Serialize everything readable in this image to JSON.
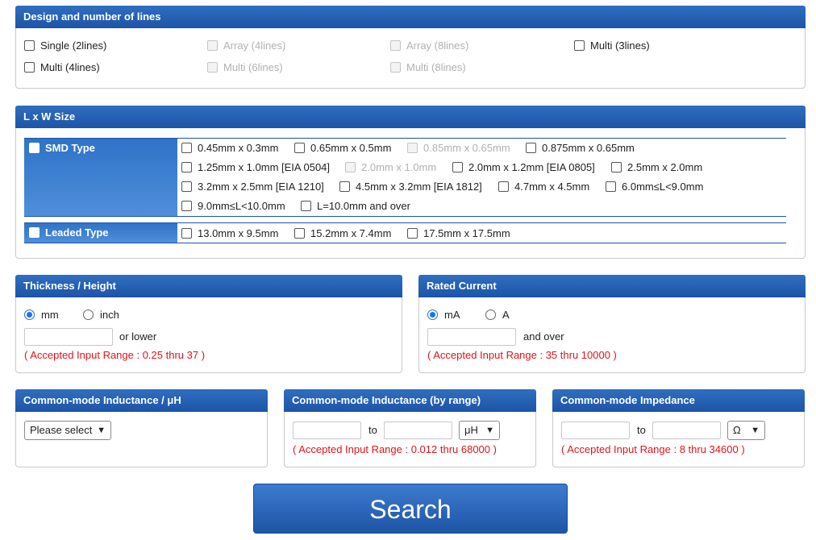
{
  "design": {
    "title": "Design and number of lines",
    "options": [
      {
        "label": "Single (2lines)",
        "disabled": false
      },
      {
        "label": "Array (4lines)",
        "disabled": true
      },
      {
        "label": "Array (8lines)",
        "disabled": true
      },
      {
        "label": "Multi (3lines)",
        "disabled": false
      },
      {
        "label": "Multi (4lines)",
        "disabled": false
      },
      {
        "label": "Multi (6lines)",
        "disabled": true
      },
      {
        "label": "Multi (8lines)",
        "disabled": true
      }
    ]
  },
  "size": {
    "title": "L x W Size",
    "smd_label": "SMD Type",
    "smd_options": [
      "0.45mm x 0.3mm",
      "0.65mm x 0.5mm",
      "0.85mm x 0.65mm",
      "0.875mm x 0.65mm",
      "1.25mm x 1.0mm [EIA 0504]",
      "2.0mm x 1.0mm",
      "2.0mm x 1.2mm [EIA 0805]",
      "2.5mm x 2.0mm",
      "3.2mm x 2.5mm [EIA 1210]",
      "4.5mm x 3.2mm [EIA 1812]",
      "4.7mm x 4.5mm",
      "6.0mm≤L<9.0mm",
      "9.0mm≤L<10.0mm",
      "L=10.0mm and over"
    ],
    "leaded_label": "Leaded Type",
    "leaded_options": [
      "13.0mm x 9.5mm",
      "15.2mm x 7.4mm",
      "17.5mm x 17.5mm"
    ]
  },
  "thickness": {
    "title": "Thickness / Height",
    "unit_mm": "mm",
    "unit_inch": "inch",
    "suffix": "or lower",
    "range": "( Accepted Input Range : 0.25 thru 37 )"
  },
  "current": {
    "title": "Rated Current",
    "unit_ma": "mA",
    "unit_a": "A",
    "suffix": "and over",
    "range": "( Accepted Input Range : 35 thru 10000 )"
  },
  "inductance": {
    "title": "Common-mode Inductance / μH",
    "select_value": "Please select"
  },
  "inductance_range": {
    "title": "Common-mode Inductance (by range)",
    "to": "to",
    "unit": "μH",
    "range": "( Accepted Input Range : 0.012 thru 68000 )"
  },
  "impedance": {
    "title": "Common-mode Impedance",
    "to": "to",
    "unit": "Ω",
    "range": "( Accepted Input Range : 8 thru 34600 )"
  },
  "search_label": "Search"
}
